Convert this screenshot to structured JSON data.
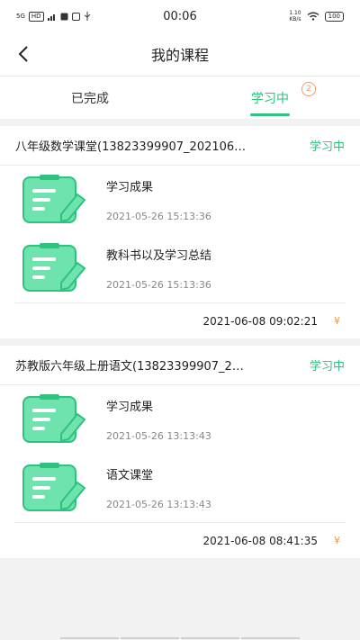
{
  "status_bar": {
    "left_items": [
      "5G",
      "HD"
    ],
    "time": "00:06",
    "speed_value": "1.10",
    "speed_unit": "KB/s",
    "battery": "100"
  },
  "header": {
    "title": "我的课程",
    "back_icon": "chevron-left-icon"
  },
  "tabs": [
    {
      "label": "已完成",
      "active": false
    },
    {
      "label": "学习中",
      "active": true,
      "badge": "2"
    }
  ],
  "colors": {
    "accent": "#2ec27e",
    "badge": "#f29a6b",
    "yen": "#f29a3b",
    "icon_fill": "#6ee3ad",
    "icon_stroke": "#2ec27e"
  },
  "courses": [
    {
      "name": "八年级数学课堂(13823399907_202106…",
      "status": "学习中",
      "lessons": [
        {
          "name": "学习成果",
          "time": "2021-05-26 15:13:36"
        },
        {
          "name": "教科书以及学习总结",
          "time": "2021-05-26 15:13:36"
        }
      ],
      "footer_time": "2021-06-08 09:02:21",
      "footer_yen": "¥"
    },
    {
      "name": "苏教版六年级上册语文(13823399907_2…",
      "status": "学习中",
      "lessons": [
        {
          "name": "学习成果",
          "time": "2021-05-26 13:13:43"
        },
        {
          "name": "语文课堂",
          "time": "2021-05-26 13:13:43"
        }
      ],
      "footer_time": "2021-06-08 08:41:35",
      "footer_yen": "¥"
    }
  ]
}
